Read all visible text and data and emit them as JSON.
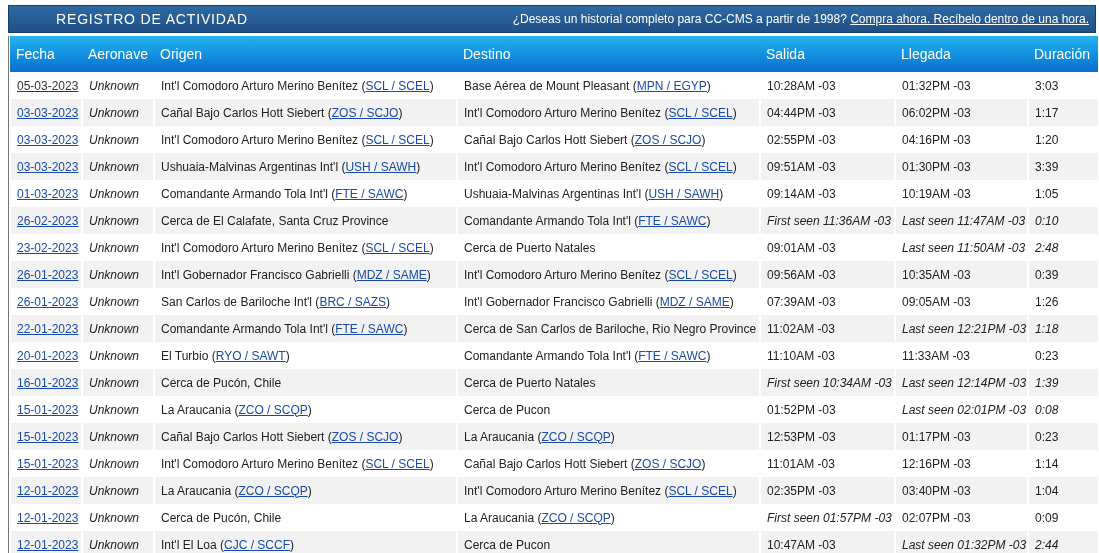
{
  "title": "REGISTRO DE ACTIVIDAD",
  "promo": {
    "text": "¿Deseas un historial completo para CC-CMS a partir de 1998?",
    "link": "Compra ahora. Recíbelo dentro de una hora."
  },
  "columns": [
    "Fecha",
    "Aeronave",
    "Origen",
    "Destino",
    "Salida",
    "Llegada",
    "Duración"
  ],
  "rows": [
    {
      "date": "05-03-2023",
      "visited": true,
      "aircraft": "Unknown",
      "origin": {
        "prefix": "Int'l Comodoro Arturo Merino Benítez (",
        "code": "SCL / SCEL",
        "suffix": ")"
      },
      "destination": {
        "prefix": "Base Aérea de Mount Pleasant (",
        "code": "MPN / EGYP",
        "suffix": ")"
      },
      "departure": {
        "text": "10:28AM -03",
        "estimated": false
      },
      "arrival": {
        "text": "01:32PM -03",
        "estimated": false
      },
      "duration": {
        "text": "3:03",
        "estimated": false
      }
    },
    {
      "date": "03-03-2023",
      "visited": false,
      "aircraft": "Unknown",
      "origin": {
        "prefix": "Cañal Bajo Carlos Hott Siebert (",
        "code": "ZOS / SCJO",
        "suffix": ")"
      },
      "destination": {
        "prefix": "Int'l Comodoro Arturo Merino Benítez (",
        "code": "SCL / SCEL",
        "suffix": ")"
      },
      "departure": {
        "text": "04:44PM -03",
        "estimated": false
      },
      "arrival": {
        "text": "06:02PM -03",
        "estimated": false
      },
      "duration": {
        "text": "1:17",
        "estimated": false
      }
    },
    {
      "date": "03-03-2023",
      "visited": false,
      "aircraft": "Unknown",
      "origin": {
        "prefix": "Int'l Comodoro Arturo Merino Benítez (",
        "code": "SCL / SCEL",
        "suffix": ")"
      },
      "destination": {
        "prefix": "Cañal Bajo Carlos Hott Siebert (",
        "code": "ZOS / SCJO",
        "suffix": ")"
      },
      "departure": {
        "text": "02:55PM -03",
        "estimated": false
      },
      "arrival": {
        "text": "04:16PM -03",
        "estimated": false
      },
      "duration": {
        "text": "1:20",
        "estimated": false
      }
    },
    {
      "date": "03-03-2023",
      "visited": false,
      "aircraft": "Unknown",
      "origin": {
        "prefix": "Ushuaia-Malvinas Argentinas Int'l (",
        "code": "USH / SAWH",
        "suffix": ")"
      },
      "destination": {
        "prefix": "Int'l Comodoro Arturo Merino Benítez (",
        "code": "SCL / SCEL",
        "suffix": ")"
      },
      "departure": {
        "text": "09:51AM -03",
        "estimated": false
      },
      "arrival": {
        "text": "01:30PM -03",
        "estimated": false
      },
      "duration": {
        "text": "3:39",
        "estimated": false
      }
    },
    {
      "date": "01-03-2023",
      "visited": false,
      "aircraft": "Unknown",
      "origin": {
        "prefix": "Comandante Armando Tola Int'l (",
        "code": "FTE / SAWC",
        "suffix": ")"
      },
      "destination": {
        "prefix": "Ushuaia-Malvinas Argentinas Int'l (",
        "code": "USH / SAWH",
        "suffix": ")"
      },
      "departure": {
        "text": "09:14AM -03",
        "estimated": false
      },
      "arrival": {
        "text": "10:19AM -03",
        "estimated": false
      },
      "duration": {
        "text": "1:05",
        "estimated": false
      }
    },
    {
      "date": "26-02-2023",
      "visited": false,
      "aircraft": "Unknown",
      "origin": {
        "prefix": "Cerca de El Calafate, Santa Cruz Province"
      },
      "destination": {
        "prefix": "Comandante Armando Tola Int'l (",
        "code": "FTE / SAWC",
        "suffix": ")"
      },
      "departure": {
        "text": "First seen 11:36AM -03",
        "estimated": true
      },
      "arrival": {
        "text": "Last seen 11:47AM -03",
        "estimated": true
      },
      "duration": {
        "text": "0:10",
        "estimated": true
      }
    },
    {
      "date": "23-02-2023",
      "visited": false,
      "aircraft": "Unknown",
      "origin": {
        "prefix": "Int'l Comodoro Arturo Merino Benítez (",
        "code": "SCL / SCEL",
        "suffix": ")"
      },
      "destination": {
        "prefix": "Cerca de Puerto Natales"
      },
      "departure": {
        "text": "09:01AM -03",
        "estimated": false
      },
      "arrival": {
        "text": "Last seen 11:50AM -03",
        "estimated": true
      },
      "duration": {
        "text": "2:48",
        "estimated": true
      }
    },
    {
      "date": "26-01-2023",
      "visited": false,
      "aircraft": "Unknown",
      "origin": {
        "prefix": "Int'l Gobernador Francisco Gabrielli (",
        "code": "MDZ / SAME",
        "suffix": ")"
      },
      "destination": {
        "prefix": "Int'l Comodoro Arturo Merino Benítez (",
        "code": "SCL / SCEL",
        "suffix": ")"
      },
      "departure": {
        "text": "09:56AM -03",
        "estimated": false
      },
      "arrival": {
        "text": "10:35AM -03",
        "estimated": false
      },
      "duration": {
        "text": "0:39",
        "estimated": false
      }
    },
    {
      "date": "26-01-2023",
      "visited": false,
      "aircraft": "Unknown",
      "origin": {
        "prefix": "San Carlos de Bariloche Int'l (",
        "code": "BRC / SAZS",
        "suffix": ")"
      },
      "destination": {
        "prefix": "Int'l Gobernador Francisco Gabrielli (",
        "code": "MDZ / SAME",
        "suffix": ")"
      },
      "departure": {
        "text": "07:39AM -03",
        "estimated": false
      },
      "arrival": {
        "text": "09:05AM -03",
        "estimated": false
      },
      "duration": {
        "text": "1:26",
        "estimated": false
      }
    },
    {
      "date": "22-01-2023",
      "visited": false,
      "aircraft": "Unknown",
      "origin": {
        "prefix": "Comandante Armando Tola Int'l (",
        "code": "FTE / SAWC",
        "suffix": ")"
      },
      "destination": {
        "prefix": "Cerca de San Carlos de Bariloche, Rio Negro Province"
      },
      "departure": {
        "text": "11:02AM -03",
        "estimated": false
      },
      "arrival": {
        "text": "Last seen 12:21PM -03",
        "estimated": true
      },
      "duration": {
        "text": "1:18",
        "estimated": true
      }
    },
    {
      "date": "20-01-2023",
      "visited": false,
      "aircraft": "Unknown",
      "origin": {
        "prefix": "El Turbio (",
        "code": "RYO / SAWT",
        "suffix": ")"
      },
      "destination": {
        "prefix": "Comandante Armando Tola Int'l (",
        "code": "FTE / SAWC",
        "suffix": ")"
      },
      "departure": {
        "text": "11:10AM -03",
        "estimated": false
      },
      "arrival": {
        "text": "11:33AM -03",
        "estimated": false
      },
      "duration": {
        "text": "0:23",
        "estimated": false
      }
    },
    {
      "date": "16-01-2023",
      "visited": false,
      "aircraft": "Unknown",
      "origin": {
        "prefix": "Cerca de Pucón, Chile"
      },
      "destination": {
        "prefix": "Cerca de Puerto Natales"
      },
      "departure": {
        "text": "First seen 10:34AM -03",
        "estimated": true
      },
      "arrival": {
        "text": "Last seen 12:14PM -03",
        "estimated": true
      },
      "duration": {
        "text": "1:39",
        "estimated": true
      }
    },
    {
      "date": "15-01-2023",
      "visited": false,
      "aircraft": "Unknown",
      "origin": {
        "prefix": "La Araucania (",
        "code": "ZCO / SCQP",
        "suffix": ")"
      },
      "destination": {
        "prefix": "Cerca de Pucon"
      },
      "departure": {
        "text": "01:52PM -03",
        "estimated": false
      },
      "arrival": {
        "text": "Last seen 02:01PM -03",
        "estimated": true
      },
      "duration": {
        "text": "0:08",
        "estimated": true
      }
    },
    {
      "date": "15-01-2023",
      "visited": false,
      "aircraft": "Unknown",
      "origin": {
        "prefix": "Cañal Bajo Carlos Hott Siebert (",
        "code": "ZOS / SCJO",
        "suffix": ")"
      },
      "destination": {
        "prefix": "La Araucania (",
        "code": "ZCO / SCQP",
        "suffix": ")"
      },
      "departure": {
        "text": "12:53PM -03",
        "estimated": false
      },
      "arrival": {
        "text": "01:17PM -03",
        "estimated": false
      },
      "duration": {
        "text": "0:23",
        "estimated": false
      }
    },
    {
      "date": "15-01-2023",
      "visited": false,
      "aircraft": "Unknown",
      "origin": {
        "prefix": "Int'l Comodoro Arturo Merino Benítez (",
        "code": "SCL / SCEL",
        "suffix": ")"
      },
      "destination": {
        "prefix": "Cañal Bajo Carlos Hott Siebert (",
        "code": "ZOS / SCJO",
        "suffix": ")"
      },
      "departure": {
        "text": "11:01AM -03",
        "estimated": false
      },
      "arrival": {
        "text": "12:16PM -03",
        "estimated": false
      },
      "duration": {
        "text": "1:14",
        "estimated": false
      }
    },
    {
      "date": "12-01-2023",
      "visited": false,
      "aircraft": "Unknown",
      "origin": {
        "prefix": "La Araucania (",
        "code": "ZCO / SCQP",
        "suffix": ")"
      },
      "destination": {
        "prefix": "Int'l Comodoro Arturo Merino Benítez (",
        "code": "SCL / SCEL",
        "suffix": ")"
      },
      "departure": {
        "text": "02:35PM -03",
        "estimated": false
      },
      "arrival": {
        "text": "03:40PM -03",
        "estimated": false
      },
      "duration": {
        "text": "1:04",
        "estimated": false
      }
    },
    {
      "date": "12-01-2023",
      "visited": false,
      "aircraft": "Unknown",
      "origin": {
        "prefix": "Cerca de Pucón, Chile"
      },
      "destination": {
        "prefix": "La Araucania (",
        "code": "ZCO / SCQP",
        "suffix": ")"
      },
      "departure": {
        "text": "First seen 01:57PM -03",
        "estimated": true
      },
      "arrival": {
        "text": "02:07PM -03",
        "estimated": false
      },
      "duration": {
        "text": "0:09",
        "estimated": false
      }
    },
    {
      "date": "12-01-2023",
      "visited": false,
      "aircraft": "Unknown",
      "origin": {
        "prefix": "Int'l El Loa (",
        "code": "CJC / SCCF",
        "suffix": ")"
      },
      "destination": {
        "prefix": "Cerca de Pucon"
      },
      "departure": {
        "text": "10:47AM -03",
        "estimated": false
      },
      "arrival": {
        "text": "Last seen 01:32PM -03",
        "estimated": true
      },
      "duration": {
        "text": "2:44",
        "estimated": true
      }
    }
  ]
}
